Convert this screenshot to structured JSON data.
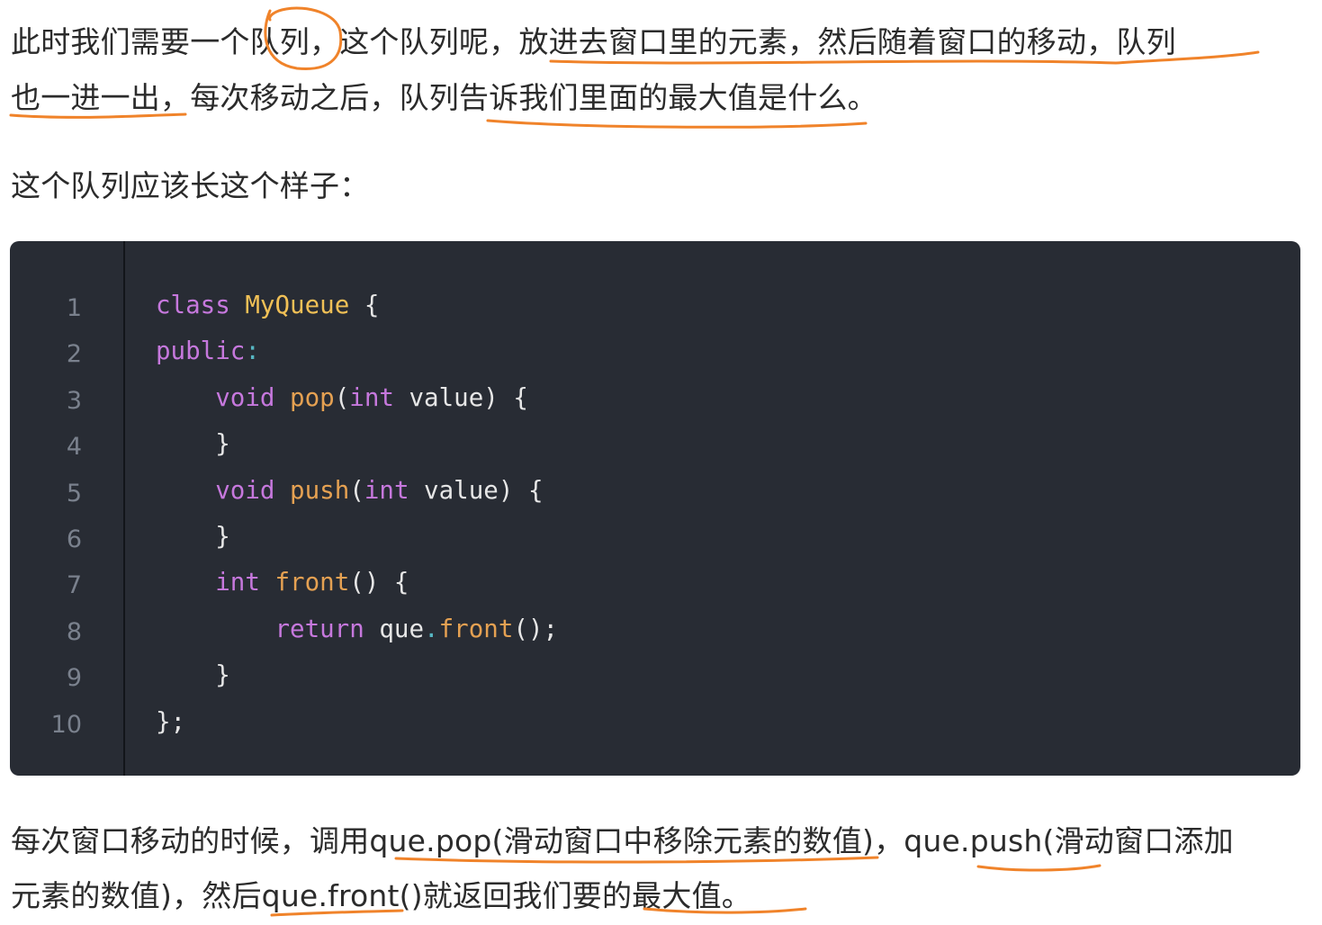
{
  "paragraph1": {
    "line1": "此时我们需要一个队列，这个队列呢，放进去窗口里的元素，然后随着窗口的移动，队列",
    "line2": "也一进一出，每次移动之后，队列告诉我们里面的最大值是什么。"
  },
  "paragraph2": "这个队列应该长这个样子：",
  "code": {
    "line_numbers": [
      "1",
      "2",
      "3",
      "4",
      "5",
      "6",
      "7",
      "8",
      "9",
      "10"
    ],
    "lines": [
      [
        {
          "t": "class",
          "c": "kw"
        },
        {
          "t": " ",
          "c": "pl"
        },
        {
          "t": "MyQueue",
          "c": "cls"
        },
        {
          "t": " {",
          "c": "pl"
        }
      ],
      [
        {
          "t": "public",
          "c": "kw"
        },
        {
          "t": ":",
          "c": "pu"
        }
      ],
      [
        {
          "t": "    ",
          "c": "pl"
        },
        {
          "t": "void",
          "c": "kw"
        },
        {
          "t": " ",
          "c": "pl"
        },
        {
          "t": "pop",
          "c": "fn"
        },
        {
          "t": "(",
          "c": "pl"
        },
        {
          "t": "int",
          "c": "kw"
        },
        {
          "t": " value) {",
          "c": "pl"
        }
      ],
      [
        {
          "t": "    }",
          "c": "pl"
        }
      ],
      [
        {
          "t": "    ",
          "c": "pl"
        },
        {
          "t": "void",
          "c": "kw"
        },
        {
          "t": " ",
          "c": "pl"
        },
        {
          "t": "push",
          "c": "fn"
        },
        {
          "t": "(",
          "c": "pl"
        },
        {
          "t": "int",
          "c": "kw"
        },
        {
          "t": " value) {",
          "c": "pl"
        }
      ],
      [
        {
          "t": "    }",
          "c": "pl"
        }
      ],
      [
        {
          "t": "    ",
          "c": "pl"
        },
        {
          "t": "int",
          "c": "kw"
        },
        {
          "t": " ",
          "c": "pl"
        },
        {
          "t": "front",
          "c": "fn"
        },
        {
          "t": "() {",
          "c": "pl"
        }
      ],
      [
        {
          "t": "        ",
          "c": "pl"
        },
        {
          "t": "return",
          "c": "kw"
        },
        {
          "t": " que",
          "c": "pl"
        },
        {
          "t": ".",
          "c": "pu"
        },
        {
          "t": "front",
          "c": "fn"
        },
        {
          "t": "();",
          "c": "pl"
        }
      ],
      [
        {
          "t": "    }",
          "c": "pl"
        }
      ],
      [
        {
          "t": "};",
          "c": "pl"
        }
      ]
    ]
  },
  "paragraph3": {
    "line1": "每次窗口移动的时候，调用que.pop(滑动窗口中移除元素的数值)，que.push(滑动窗口添加",
    "line2": "元素的数值)，然后que.front()就返回我们要的最大值。"
  },
  "colors": {
    "annotation": "#f0832a",
    "code_background": "#282c34",
    "keyword": "#c678dd",
    "function": "#e5a152",
    "class_name": "#f0c056"
  }
}
